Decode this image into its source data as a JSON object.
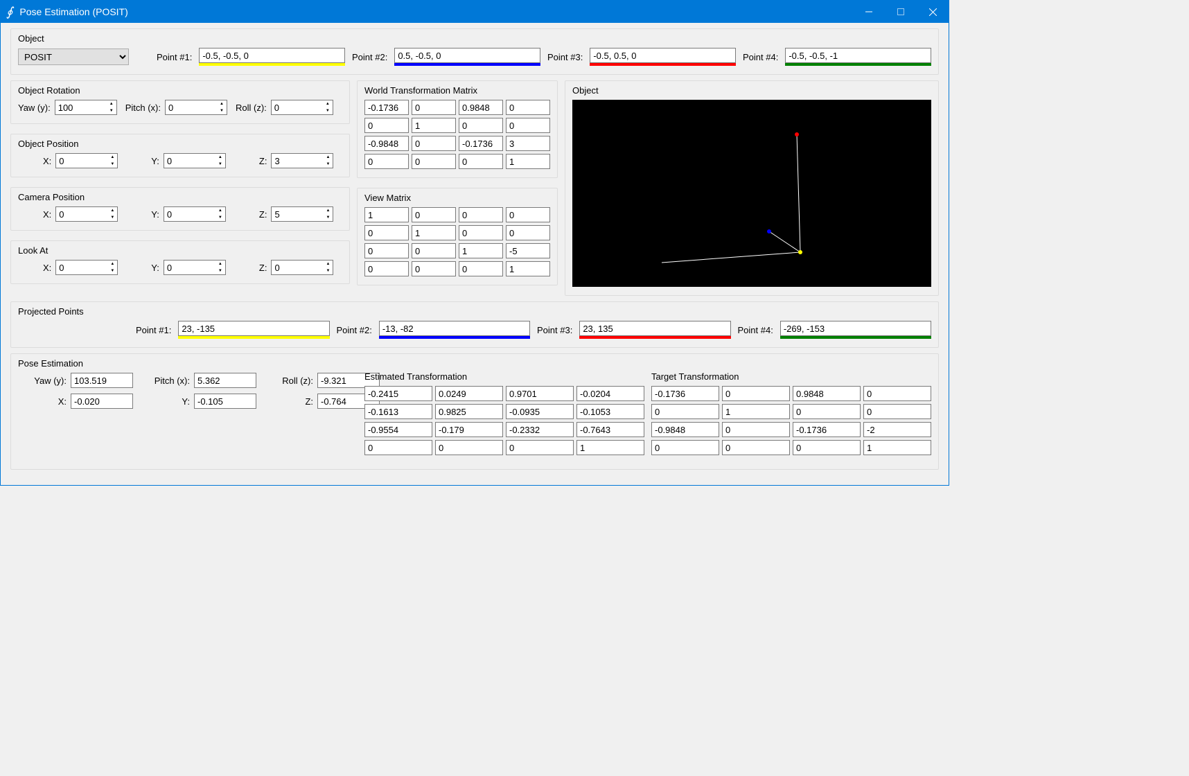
{
  "window": {
    "title": "Pose Estimation (POSIT)"
  },
  "object": {
    "title": "Object",
    "algorithm_selected": "POSIT",
    "points": [
      {
        "label": "Point #1:",
        "value": "-0.5, -0.5, 0",
        "color": "yellow"
      },
      {
        "label": "Point #2:",
        "value": "0.5, -0.5, 0",
        "color": "blue"
      },
      {
        "label": "Point #3:",
        "value": "-0.5, 0.5, 0",
        "color": "red"
      },
      {
        "label": "Point #4:",
        "value": "-0.5, -0.5, -1",
        "color": "green"
      }
    ]
  },
  "rotation": {
    "title": "Object Rotation",
    "yaw_label": "Yaw (y):",
    "yaw": "100",
    "pitch_label": "Pitch (x):",
    "pitch": "0",
    "roll_label": "Roll (z):",
    "roll": "0"
  },
  "position": {
    "title": "Object Position",
    "x_label": "X:",
    "x": "0",
    "y_label": "Y:",
    "y": "0",
    "z_label": "Z:",
    "z": "3"
  },
  "camera": {
    "title": "Camera Position",
    "x_label": "X:",
    "x": "0",
    "y_label": "Y:",
    "y": "0",
    "z_label": "Z:",
    "z": "5"
  },
  "lookat": {
    "title": "Look At",
    "x_label": "X:",
    "x": "0",
    "y_label": "Y:",
    "y": "0",
    "z_label": "Z:",
    "z": "0"
  },
  "world_matrix": {
    "title": "World Transformation Matrix",
    "cells": [
      "-0.1736",
      "0",
      "0.9848",
      "0",
      "0",
      "1",
      "0",
      "0",
      "-0.9848",
      "0",
      "-0.1736",
      "3",
      "0",
      "0",
      "0",
      "1"
    ]
  },
  "view_matrix": {
    "title": "View Matrix",
    "cells": [
      "1",
      "0",
      "0",
      "0",
      "0",
      "1",
      "0",
      "0",
      "0",
      "0",
      "1",
      "-5",
      "0",
      "0",
      "0",
      "1"
    ]
  },
  "viewport": {
    "title": "Object"
  },
  "projected": {
    "title": "Projected Points",
    "points": [
      {
        "label": "Point #1:",
        "value": "23, -135",
        "color": "yellow"
      },
      {
        "label": "Point #2:",
        "value": "-13, -82",
        "color": "blue"
      },
      {
        "label": "Point #3:",
        "value": "23, 135",
        "color": "red"
      },
      {
        "label": "Point #4:",
        "value": "-269, -153",
        "color": "green"
      }
    ]
  },
  "pose": {
    "title": "Pose Estimation",
    "yaw_label": "Yaw (y):",
    "yaw": "103.519",
    "pitch_label": "Pitch (x):",
    "pitch": "5.362",
    "roll_label": "Roll (z):",
    "roll": "-9.321",
    "x_label": "X:",
    "x": "-0.020",
    "y_label": "Y:",
    "y": "-0.105",
    "z_label": "Z:",
    "z": "-0.764",
    "estimated": {
      "title": "Estimated Transformation",
      "cells": [
        "-0.2415",
        "0.0249",
        "0.9701",
        "-0.0204",
        "-0.1613",
        "0.9825",
        "-0.0935",
        "-0.1053",
        "-0.9554",
        "-0.179",
        "-0.2332",
        "-0.7643",
        "0",
        "0",
        "0",
        "1"
      ]
    },
    "target": {
      "title": "Target Transformation",
      "cells": [
        "-0.1736",
        "0",
        "0.9848",
        "0",
        "0",
        "1",
        "0",
        "0",
        "-0.9848",
        "0",
        "-0.1736",
        "-2",
        "0",
        "0",
        "0",
        "1"
      ]
    }
  }
}
